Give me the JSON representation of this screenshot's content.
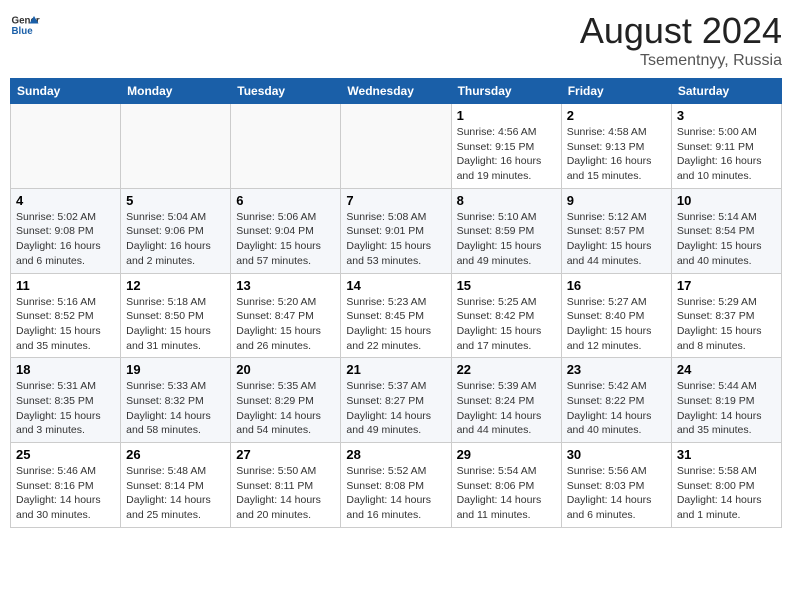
{
  "logo": {
    "general": "General",
    "blue": "Blue"
  },
  "header": {
    "month_year": "August 2024",
    "location": "Tsementnyy, Russia"
  },
  "weekdays": [
    "Sunday",
    "Monday",
    "Tuesday",
    "Wednesday",
    "Thursday",
    "Friday",
    "Saturday"
  ],
  "weeks": [
    [
      {
        "day": "",
        "info": ""
      },
      {
        "day": "",
        "info": ""
      },
      {
        "day": "",
        "info": ""
      },
      {
        "day": "",
        "info": ""
      },
      {
        "day": "1",
        "info": "Sunrise: 4:56 AM\nSunset: 9:15 PM\nDaylight: 16 hours\nand 19 minutes."
      },
      {
        "day": "2",
        "info": "Sunrise: 4:58 AM\nSunset: 9:13 PM\nDaylight: 16 hours\nand 15 minutes."
      },
      {
        "day": "3",
        "info": "Sunrise: 5:00 AM\nSunset: 9:11 PM\nDaylight: 16 hours\nand 10 minutes."
      }
    ],
    [
      {
        "day": "4",
        "info": "Sunrise: 5:02 AM\nSunset: 9:08 PM\nDaylight: 16 hours\nand 6 minutes."
      },
      {
        "day": "5",
        "info": "Sunrise: 5:04 AM\nSunset: 9:06 PM\nDaylight: 16 hours\nand 2 minutes."
      },
      {
        "day": "6",
        "info": "Sunrise: 5:06 AM\nSunset: 9:04 PM\nDaylight: 15 hours\nand 57 minutes."
      },
      {
        "day": "7",
        "info": "Sunrise: 5:08 AM\nSunset: 9:01 PM\nDaylight: 15 hours\nand 53 minutes."
      },
      {
        "day": "8",
        "info": "Sunrise: 5:10 AM\nSunset: 8:59 PM\nDaylight: 15 hours\nand 49 minutes."
      },
      {
        "day": "9",
        "info": "Sunrise: 5:12 AM\nSunset: 8:57 PM\nDaylight: 15 hours\nand 44 minutes."
      },
      {
        "day": "10",
        "info": "Sunrise: 5:14 AM\nSunset: 8:54 PM\nDaylight: 15 hours\nand 40 minutes."
      }
    ],
    [
      {
        "day": "11",
        "info": "Sunrise: 5:16 AM\nSunset: 8:52 PM\nDaylight: 15 hours\nand 35 minutes."
      },
      {
        "day": "12",
        "info": "Sunrise: 5:18 AM\nSunset: 8:50 PM\nDaylight: 15 hours\nand 31 minutes."
      },
      {
        "day": "13",
        "info": "Sunrise: 5:20 AM\nSunset: 8:47 PM\nDaylight: 15 hours\nand 26 minutes."
      },
      {
        "day": "14",
        "info": "Sunrise: 5:23 AM\nSunset: 8:45 PM\nDaylight: 15 hours\nand 22 minutes."
      },
      {
        "day": "15",
        "info": "Sunrise: 5:25 AM\nSunset: 8:42 PM\nDaylight: 15 hours\nand 17 minutes."
      },
      {
        "day": "16",
        "info": "Sunrise: 5:27 AM\nSunset: 8:40 PM\nDaylight: 15 hours\nand 12 minutes."
      },
      {
        "day": "17",
        "info": "Sunrise: 5:29 AM\nSunset: 8:37 PM\nDaylight: 15 hours\nand 8 minutes."
      }
    ],
    [
      {
        "day": "18",
        "info": "Sunrise: 5:31 AM\nSunset: 8:35 PM\nDaylight: 15 hours\nand 3 minutes."
      },
      {
        "day": "19",
        "info": "Sunrise: 5:33 AM\nSunset: 8:32 PM\nDaylight: 14 hours\nand 58 minutes."
      },
      {
        "day": "20",
        "info": "Sunrise: 5:35 AM\nSunset: 8:29 PM\nDaylight: 14 hours\nand 54 minutes."
      },
      {
        "day": "21",
        "info": "Sunrise: 5:37 AM\nSunset: 8:27 PM\nDaylight: 14 hours\nand 49 minutes."
      },
      {
        "day": "22",
        "info": "Sunrise: 5:39 AM\nSunset: 8:24 PM\nDaylight: 14 hours\nand 44 minutes."
      },
      {
        "day": "23",
        "info": "Sunrise: 5:42 AM\nSunset: 8:22 PM\nDaylight: 14 hours\nand 40 minutes."
      },
      {
        "day": "24",
        "info": "Sunrise: 5:44 AM\nSunset: 8:19 PM\nDaylight: 14 hours\nand 35 minutes."
      }
    ],
    [
      {
        "day": "25",
        "info": "Sunrise: 5:46 AM\nSunset: 8:16 PM\nDaylight: 14 hours\nand 30 minutes."
      },
      {
        "day": "26",
        "info": "Sunrise: 5:48 AM\nSunset: 8:14 PM\nDaylight: 14 hours\nand 25 minutes."
      },
      {
        "day": "27",
        "info": "Sunrise: 5:50 AM\nSunset: 8:11 PM\nDaylight: 14 hours\nand 20 minutes."
      },
      {
        "day": "28",
        "info": "Sunrise: 5:52 AM\nSunset: 8:08 PM\nDaylight: 14 hours\nand 16 minutes."
      },
      {
        "day": "29",
        "info": "Sunrise: 5:54 AM\nSunset: 8:06 PM\nDaylight: 14 hours\nand 11 minutes."
      },
      {
        "day": "30",
        "info": "Sunrise: 5:56 AM\nSunset: 8:03 PM\nDaylight: 14 hours\nand 6 minutes."
      },
      {
        "day": "31",
        "info": "Sunrise: 5:58 AM\nSunset: 8:00 PM\nDaylight: 14 hours\nand 1 minute."
      }
    ]
  ]
}
